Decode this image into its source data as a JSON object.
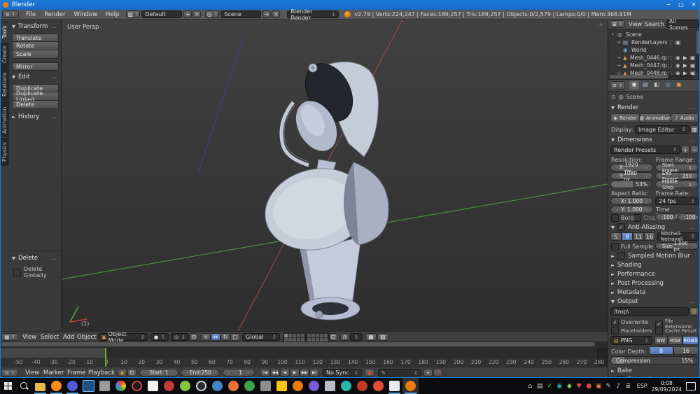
{
  "window": {
    "title": "Blender",
    "minimize": "─",
    "maximize": "□",
    "close": "×"
  },
  "infobar": {
    "menus": [
      "File",
      "Render",
      "Window",
      "Help"
    ],
    "layout": "Default",
    "scene_name": "Scene",
    "engine": "Blender Render",
    "stats": "v2.79 | Verts:224,247 | Faces:189,257 | Tris:189,257 | Objects:0/2,579 | Lamps:0/0 | Mem:368.91M",
    "add": "+",
    "remove": "×"
  },
  "icons": {
    "collapse": "▼",
    "expand": "►",
    "updown": "↕",
    "dots": "…",
    "check": "✓",
    "pipe": "|",
    "plus": "+",
    "minus": "−"
  },
  "toolshelf": {
    "tabs": [
      "Tools",
      "Create",
      "Relations",
      "Animation",
      "Physics"
    ],
    "transform_title": "Transform",
    "transform_buttons": [
      "Translate",
      "Rotate",
      "Scale"
    ],
    "mirror": "Mirror",
    "edit_title": "Edit",
    "edit_buttons": [
      "Duplicate",
      "Duplicate Linked",
      "Delete"
    ],
    "history_title": "History",
    "operator_title": "Delete",
    "operator_option": "Delete Globally"
  },
  "viewport": {
    "view_label": "User Persp",
    "frame_label": "(1)",
    "menus": [
      "View",
      "Select",
      "Add",
      "Object"
    ],
    "mode": "Object Mode",
    "orientation": "Global"
  },
  "outliner": {
    "menus": [
      "View",
      "Search"
    ],
    "filter": "All Scenes",
    "scene": "Scene",
    "renderlayers": "RenderLayers",
    "world": "World",
    "meshes": [
      "Mesh_0446.rp",
      "Mesh_0447.rp",
      "Mesh_0448.rp"
    ]
  },
  "properties": {
    "context": "Scene",
    "render_title": "Render",
    "render_btn": "Render",
    "animation_btn": "Animation",
    "audio_btn": "Audio",
    "display_label": "Display:",
    "display_value": "Image Editor",
    "dim_title": "Dimensions",
    "presets": "Render Presets",
    "resolution_label": "Resolution:",
    "res_x": "X:",
    "res_x_val": "1920 px",
    "res_y": "Y:",
    "res_y_val": "1080 px",
    "res_pct": "53%",
    "range_label": "Frame Range:",
    "start": "Start Frame:",
    "start_val": "1",
    "end": "End Frame:",
    "end_val": "250",
    "step": "Frame Step:",
    "step_val": "1",
    "aspect_label": "Aspect Ratio:",
    "asp_x": "X:",
    "asp_x_val": "1.000",
    "asp_y": "Y:",
    "asp_y_val": "1.000",
    "border_cb": "Bord",
    "crop_cb": "Crop",
    "fps_label": "Frame Rate:",
    "fps": "24 fps",
    "remap_label": "Time Remapping:",
    "remap_a": ":100",
    "remap_b": ":100",
    "aa_title": "Anti-Aliasing",
    "aa_samples": [
      "5",
      "8",
      "11",
      "16"
    ],
    "aa_filter": "Mitchell-Netravali",
    "full_sample": "Full Sample",
    "aa_size": "Size:",
    "aa_size_val": "1.000 px",
    "motion_blur": "Sampled Motion Blur",
    "collapsed": [
      "Shading",
      "Performance",
      "Post Processing",
      "Metadata"
    ],
    "output_title": "Output",
    "path": "/tmp\\",
    "overwrite": "Overwrite",
    "file_ext": "File Extensions",
    "placeholders": "Placeholders",
    "cache": "Cache Result",
    "format": "PNG",
    "modes": [
      "BW",
      "RGB",
      "RGBA"
    ],
    "depth_label": "Color Depth:",
    "depths": [
      "8",
      "16"
    ],
    "compression": "Compression:",
    "compression_pct": "15%",
    "bake": "Bake",
    "freestyle": "Freestyle"
  },
  "timeline": {
    "ticks": [
      -50,
      -40,
      -30,
      -20,
      -10,
      0,
      10,
      20,
      30,
      40,
      50,
      60,
      70,
      80,
      90,
      100,
      110,
      120,
      130,
      140,
      150,
      160,
      170,
      180,
      190,
      200,
      210,
      220,
      230,
      240,
      250,
      260,
      270,
      280
    ],
    "menus": [
      "View",
      "Marker",
      "Frame",
      "Playback"
    ],
    "start_label": "Start:",
    "start_val": "1",
    "end_label": "End:",
    "end_val": "250",
    "current": "1",
    "sync": "No Sync",
    "play_buttons": [
      "|◀",
      "◀◀",
      "◀",
      "▶",
      "▶▶",
      "▶|"
    ]
  },
  "taskbar": {
    "lang": "ESP",
    "time": "0:08",
    "date": "29/09/2024",
    "apps": [
      {
        "name": "file-explorer",
        "color": "#e8b64c",
        "shape": "folder",
        "active": true
      },
      {
        "name": "firefox",
        "color": "#ff8c1a",
        "shape": "circle",
        "active": true
      },
      {
        "name": "messenger",
        "color": "#4f5bd5",
        "shape": "circle",
        "active": true
      },
      {
        "name": "snipping-tool",
        "color": "#1d4e89",
        "shape": "square",
        "border": "#79c0f2"
      },
      {
        "name": "gray-app",
        "color": "#9a9a9a",
        "shape": "square"
      },
      {
        "name": "chrome",
        "color": "conic",
        "shape": "circle"
      },
      {
        "name": "screen-recorder",
        "color": "#1c1c1c",
        "shape": "circle",
        "ring": "#d04747"
      },
      {
        "name": "paint-app",
        "color": "#f2f2f2",
        "shape": "square"
      },
      {
        "name": "dome-app",
        "color": "#c23b3b",
        "shape": "circle"
      },
      {
        "name": "green-app",
        "color": "#84c441",
        "shape": "circle"
      },
      {
        "name": "obs-studio",
        "color": "#2a2d34",
        "shape": "circle",
        "ring": "#cfd4dc"
      },
      {
        "name": "planet-app",
        "color": "#3f88c5",
        "shape": "circle"
      },
      {
        "name": "orange-app",
        "color": "#e8743b",
        "shape": "circle"
      },
      {
        "name": "green-tree-app",
        "color": "#3fa34d",
        "shape": "circle"
      },
      {
        "name": "camera-app",
        "color": "#8d8d8d",
        "shape": "square"
      },
      {
        "name": "notes-app",
        "color": "#f5c518",
        "shape": "square"
      },
      {
        "name": "audio-app",
        "color": "#e87d0d",
        "shape": "circle"
      },
      {
        "name": "purple-app",
        "color": "#7b5cd6",
        "shape": "circle"
      },
      {
        "name": "pickaxe-app",
        "color": "#b9bec6",
        "shape": "square"
      },
      {
        "name": "teal-app",
        "color": "#2ab7a9",
        "shape": "circle"
      },
      {
        "name": "heart-app",
        "color": "#c0392b",
        "shape": "circle"
      },
      {
        "name": "flash-app",
        "color": "#e04b3a",
        "shape": "circle"
      },
      {
        "name": "white-box-app",
        "color": "#e9e9ee",
        "shape": "square",
        "active": true
      },
      {
        "name": "blender",
        "color": "#e87d0d",
        "shape": "circle",
        "active": true,
        "selected": true
      }
    ],
    "tray": [
      {
        "name": "home",
        "glyph": "⌂",
        "color": "#cfcfcf"
      },
      {
        "name": "usb",
        "glyph": "▤",
        "color": "#cfcfcf"
      },
      {
        "name": "antivirus",
        "glyph": "✓",
        "color": "#7bc043"
      },
      {
        "name": "sync",
        "glyph": "◉",
        "color": "#2ab7a9"
      },
      {
        "name": "leaf",
        "glyph": "◆",
        "color": "#8fd14f"
      },
      {
        "name": "health",
        "glyph": "♥",
        "color": "#d04b4b"
      },
      {
        "name": "status",
        "glyph": "●",
        "color": "#d04b4b"
      },
      {
        "name": "box",
        "glyph": "▣",
        "color": "#e8743b"
      },
      {
        "name": "pen",
        "glyph": "✎",
        "color": "#cfcfcf"
      },
      {
        "name": "volume",
        "glyph": "♪",
        "color": "#e0e0e0"
      },
      {
        "name": "network",
        "glyph": "≣",
        "color": "#e0e0e0"
      }
    ]
  }
}
